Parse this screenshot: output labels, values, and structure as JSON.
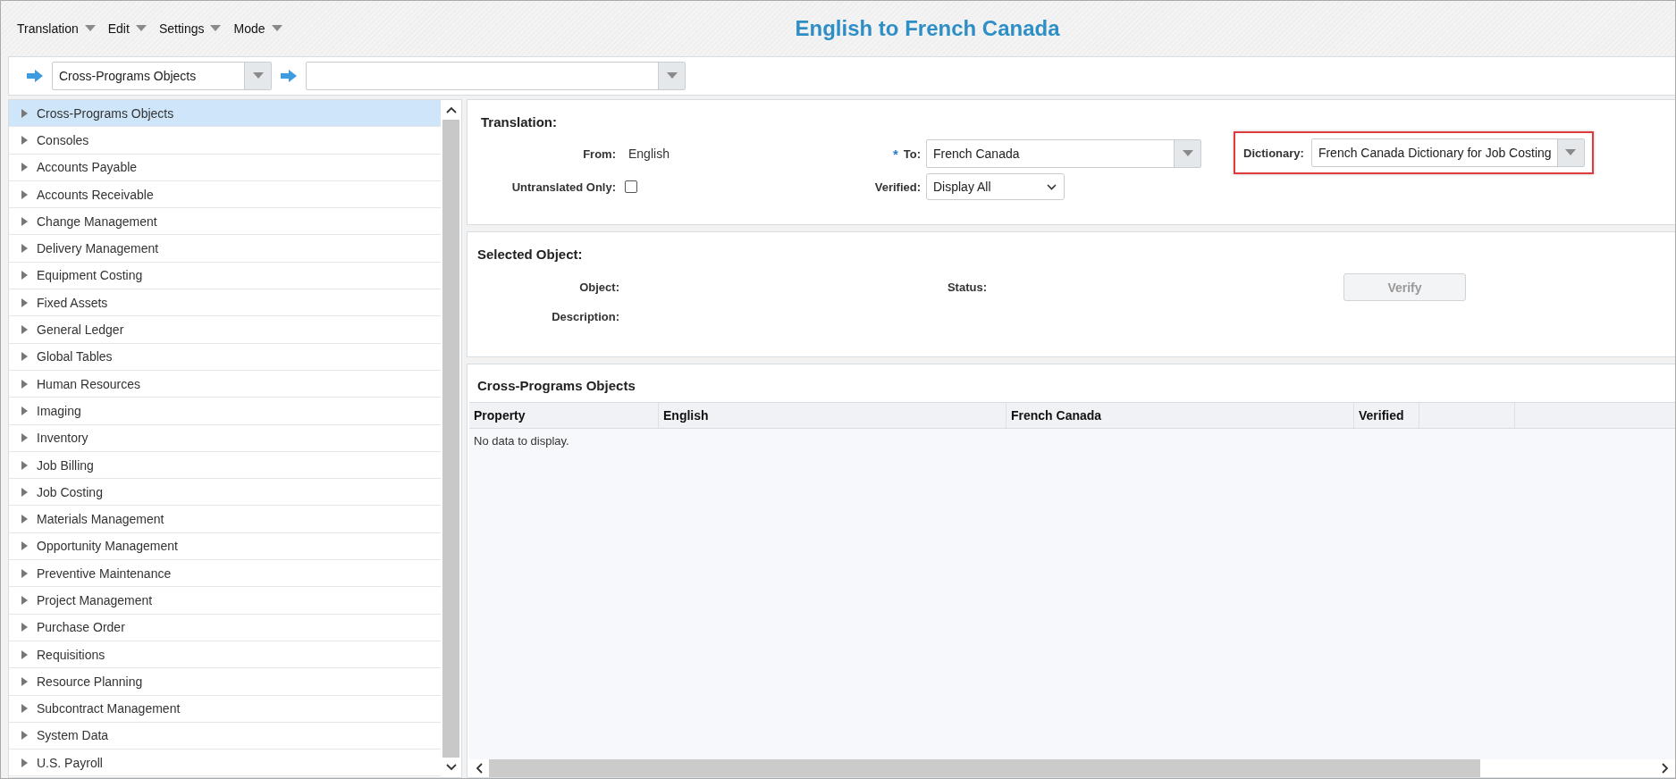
{
  "menu": [
    {
      "label": "Translation"
    },
    {
      "label": "Edit"
    },
    {
      "label": "Settings"
    },
    {
      "label": "Mode"
    }
  ],
  "title": "English to French Canada",
  "object_selector": {
    "value": "Cross-Programs Objects"
  },
  "tree": {
    "items": [
      {
        "label": "Cross-Programs Objects",
        "selected": true,
        "expanded": false
      },
      {
        "label": "Consoles",
        "selected": false,
        "expanded": false
      },
      {
        "label": "Accounts Payable",
        "selected": false,
        "expanded": false
      },
      {
        "label": "Accounts Receivable",
        "selected": false,
        "expanded": false
      },
      {
        "label": "Change Management",
        "selected": false,
        "expanded": false
      },
      {
        "label": "Delivery Management",
        "selected": false,
        "expanded": false
      },
      {
        "label": "Equipment Costing",
        "selected": false,
        "expanded": false
      },
      {
        "label": "Fixed Assets",
        "selected": false,
        "expanded": false
      },
      {
        "label": "General Ledger",
        "selected": false,
        "expanded": false
      },
      {
        "label": "Global Tables",
        "selected": false,
        "expanded": false
      },
      {
        "label": "Human Resources",
        "selected": false,
        "expanded": false
      },
      {
        "label": "Imaging",
        "selected": false,
        "expanded": false
      },
      {
        "label": "Inventory",
        "selected": false,
        "expanded": false
      },
      {
        "label": "Job Billing",
        "selected": false,
        "expanded": false
      },
      {
        "label": "Job Costing",
        "selected": false,
        "expanded": false
      },
      {
        "label": "Materials Management",
        "selected": false,
        "expanded": false
      },
      {
        "label": "Opportunity Management",
        "selected": false,
        "expanded": false
      },
      {
        "label": "Preventive Maintenance",
        "selected": false,
        "expanded": false
      },
      {
        "label": "Project Management",
        "selected": false,
        "expanded": false
      },
      {
        "label": "Purchase Order",
        "selected": false,
        "expanded": false
      },
      {
        "label": "Requisitions",
        "selected": false,
        "expanded": false
      },
      {
        "label": "Resource Planning",
        "selected": false,
        "expanded": false
      },
      {
        "label": "Subcontract Management",
        "selected": false,
        "expanded": false
      },
      {
        "label": "System Data",
        "selected": false,
        "expanded": false
      },
      {
        "label": "U.S. Payroll",
        "selected": false,
        "expanded": false
      }
    ]
  },
  "translation": {
    "heading": "Translation:",
    "from_label": "From:",
    "from_value": "English",
    "untranslated_label": "Untranslated Only:",
    "untranslated_checked": false,
    "required_mark": "*",
    "to_label": "To:",
    "to_value": "French Canada",
    "verified_label": "Verified:",
    "verified_value": "Display All",
    "dictionary_label": "Dictionary:",
    "dictionary_value": "French Canada Dictionary for Job Costing",
    "dictionary_highlighted": true
  },
  "selected_object": {
    "heading": "Selected Object:",
    "object_label": "Object:",
    "description_label": "Description:",
    "status_label": "Status:",
    "verify_button": {
      "label": "Verify",
      "disabled": true
    }
  },
  "grid": {
    "title": "Cross-Programs Objects",
    "columns": [
      "Property",
      "English",
      "French Canada",
      "Verified"
    ],
    "empty_message": "No data to display."
  }
}
